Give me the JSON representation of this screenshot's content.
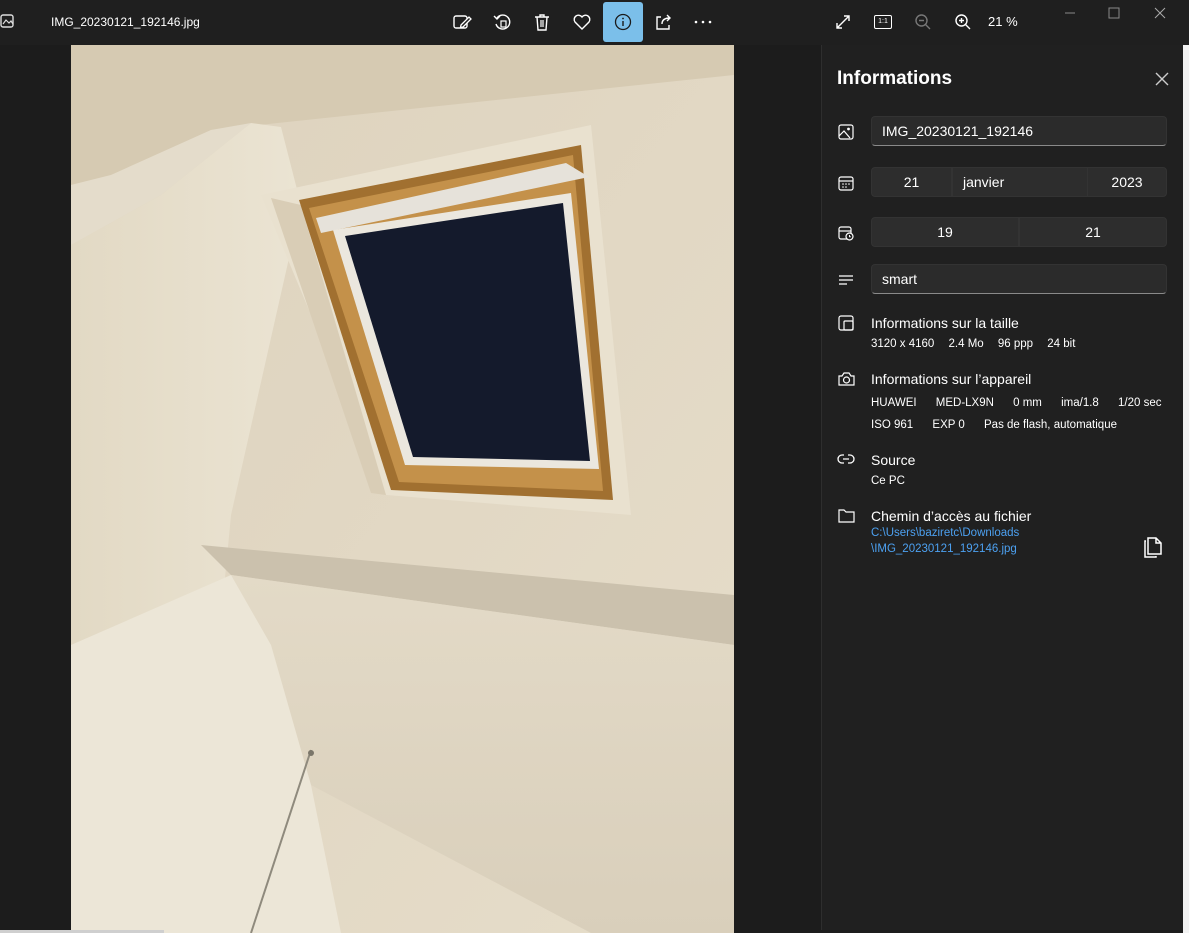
{
  "window": {
    "filename": "IMG_20230121_192146.jpg",
    "zoom_level": "21 %"
  },
  "toolbar": {
    "icons": [
      "edit-image-icon",
      "rotate-icon",
      "delete-icon",
      "favorite-icon",
      "info-icon",
      "share-icon",
      "more-icon"
    ],
    "right_icons": [
      "fullscreen-icon",
      "actual-size-icon",
      "zoom-out-icon",
      "zoom-in-icon"
    ],
    "actual_size_label": "1:1",
    "active_icon": "info-icon",
    "active_color": "#7bbfea"
  },
  "panel": {
    "title": "Informations",
    "name_value": "IMG_20230121_192146",
    "date": {
      "day": "21",
      "month": "janvier",
      "year": "2023"
    },
    "time": {
      "hour": "19",
      "minute": "21"
    },
    "caption_value": "smart",
    "size_section": {
      "title": "Informations sur la taille",
      "values": [
        "3120 x 4160",
        "2.4 Mo",
        "96 ppp",
        "24 bit"
      ]
    },
    "device_section": {
      "title": "Informations sur l’appareil",
      "line1": [
        "HUAWEI",
        "MED-LX9N",
        "0 mm",
        "ima/1.8",
        "1/20 sec"
      ],
      "line2": [
        "ISO 961",
        "EXP 0",
        "Pas de flash, automatique"
      ]
    },
    "source_section": {
      "title": "Source",
      "value": "Ce PC"
    },
    "path_section": {
      "title": "Chemin d’accès au fichier",
      "path_line1": "C:\\Users\\baziretc\\Downloads",
      "path_line2": "\\IMG_20230121_192146.jpg"
    }
  },
  "colors": {
    "link": "#4ca0f0",
    "panel_bg": "#202020",
    "window_bg": "#1c1c1c"
  }
}
